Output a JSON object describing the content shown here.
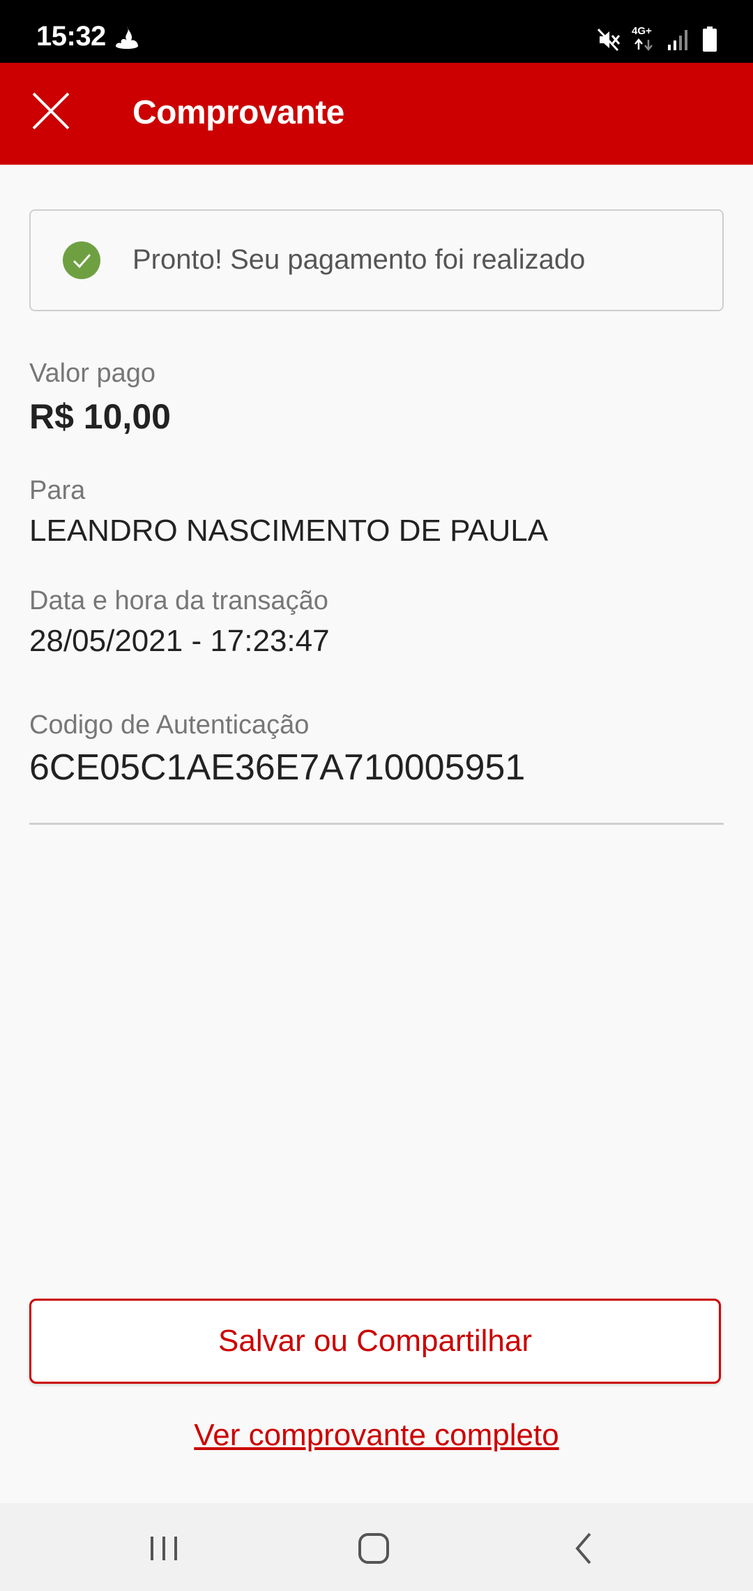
{
  "status_bar": {
    "time": "15:32",
    "network_label": "4G+",
    "icons": [
      "santander-flame-icon",
      "mute-icon",
      "signal-icon",
      "battery-icon"
    ]
  },
  "app_bar": {
    "title": "Comprovante",
    "close_icon": "close-icon",
    "color": "#cc0000"
  },
  "success_banner": {
    "icon": "check-circle-icon",
    "message": "Pronto! Seu pagamento foi realizado",
    "icon_color": "#6ea042"
  },
  "fields": {
    "amount": {
      "label": "Valor pago",
      "value": "R$ 10,00"
    },
    "recipient": {
      "label": "Para",
      "value": "LEANDRO NASCIMENTO DE PAULA"
    },
    "datetime": {
      "label": "Data e hora da transação",
      "value": "28/05/2021 - 17:23:47"
    },
    "auth_code": {
      "label": "Codigo de Autenticação",
      "value": "6CE05C1AE36E7A710005951"
    }
  },
  "actions": {
    "share_label": "Salvar ou Compartilhar",
    "full_receipt_label": "Ver comprovante completo"
  },
  "nav_bar": {
    "icons": [
      "recent-apps-icon",
      "home-icon",
      "back-icon"
    ]
  }
}
